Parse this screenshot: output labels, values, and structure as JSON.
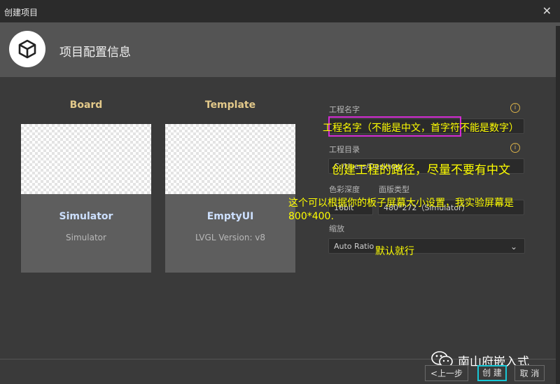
{
  "window": {
    "title": "创建项目",
    "close_symbol": "✕"
  },
  "header": {
    "title": "项目配置信息",
    "icon": "cube-logo-icon"
  },
  "columns": {
    "board_label": "Board",
    "template_label": "Template"
  },
  "cards": [
    {
      "name": "Simulator",
      "sub": "Simulator"
    },
    {
      "name": "EmptyUI",
      "sub": "LVGL Version: v8"
    }
  ],
  "form": {
    "project_name_label": "工程名字",
    "project_dir_label": "工程目录",
    "project_dir_value": "C:/Users/Desktop/",
    "color_depth_label": "色彩深度",
    "color_depth_value": "16bit",
    "board_type_label": "面版类型",
    "board_type_value": "480*272（Simulator）",
    "scale_label": "缩放",
    "scale_value": "Auto Ratio",
    "info_symbol": "i"
  },
  "annotations": {
    "name_note": "工程名字（不能是中文，首字符不能是数字）",
    "dir_note": "创建工程的路径，尽量不要有中文",
    "size_note_line1": "这个可以根据你的板子屏幕大小设置，我实验屏幕是",
    "size_note_line2": "800*400.",
    "scale_note": "默认就行"
  },
  "buttons": {
    "prev": "<上一步",
    "create": "创 建",
    "cancel": "取 消"
  },
  "watermark": {
    "text": "南山府嵌入式",
    "icon": "wechat-icon"
  }
}
